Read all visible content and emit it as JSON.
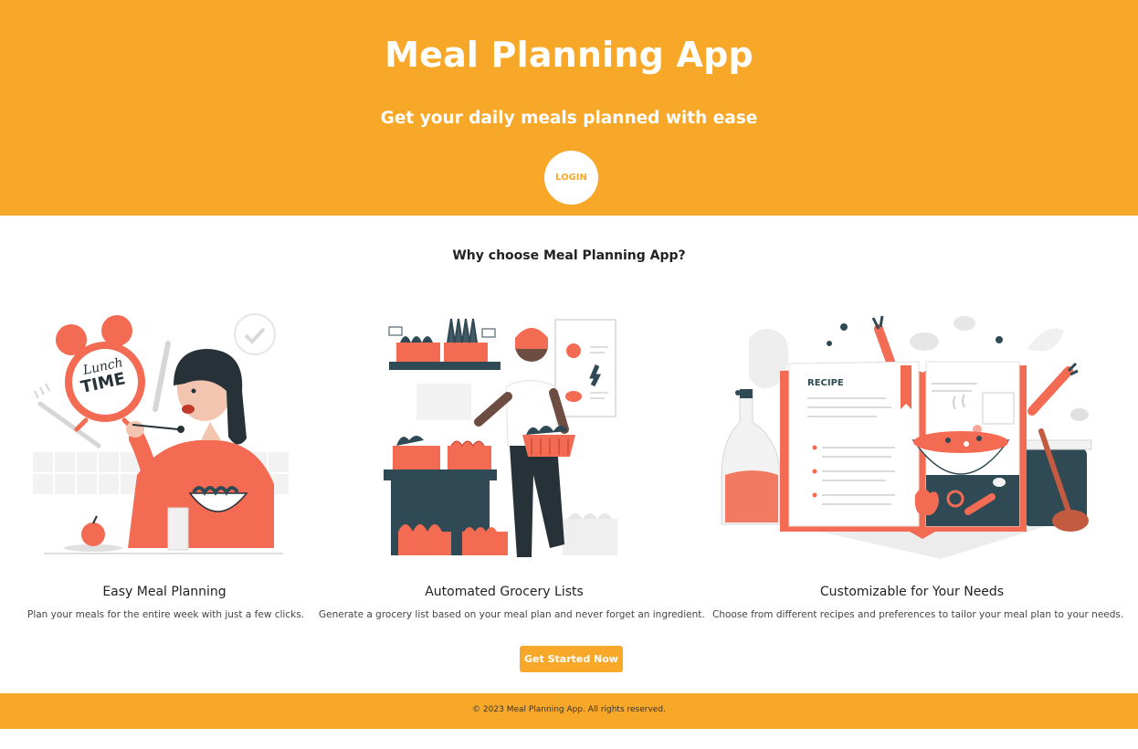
{
  "hero": {
    "title": "Meal Planning App",
    "subtitle": "Get your daily meals planned with ease",
    "login_label": "LOGIN"
  },
  "section_heading": "Why choose Meal Planning App?",
  "features": [
    {
      "title": "Easy Meal Planning",
      "description": "Plan your meals for the entire week with just a few clicks.",
      "illustration": "woman-eating-lunch-illustration"
    },
    {
      "title": "Automated Grocery Lists",
      "description": "Generate a grocery list based on your meal plan and never forget an ingredient.",
      "illustration": "grocery-shopping-illustration"
    },
    {
      "title": "Customizable for Your Needs",
      "description": "Choose from different recipes and preferences to tailor your meal plan to your needs.",
      "illustration": "recipe-book-illustration",
      "illustration_text": "RECIPE"
    }
  ],
  "clock_text": [
    "Lunch",
    "TIME"
  ],
  "cta_label": "Get Started Now",
  "footer": {
    "copyright": "© 2023 Meal Planning App. All rights reserved."
  },
  "colors": {
    "accent": "#f8a829",
    "illustration_primary": "#f26b52",
    "illustration_dark": "#2f4a55"
  }
}
